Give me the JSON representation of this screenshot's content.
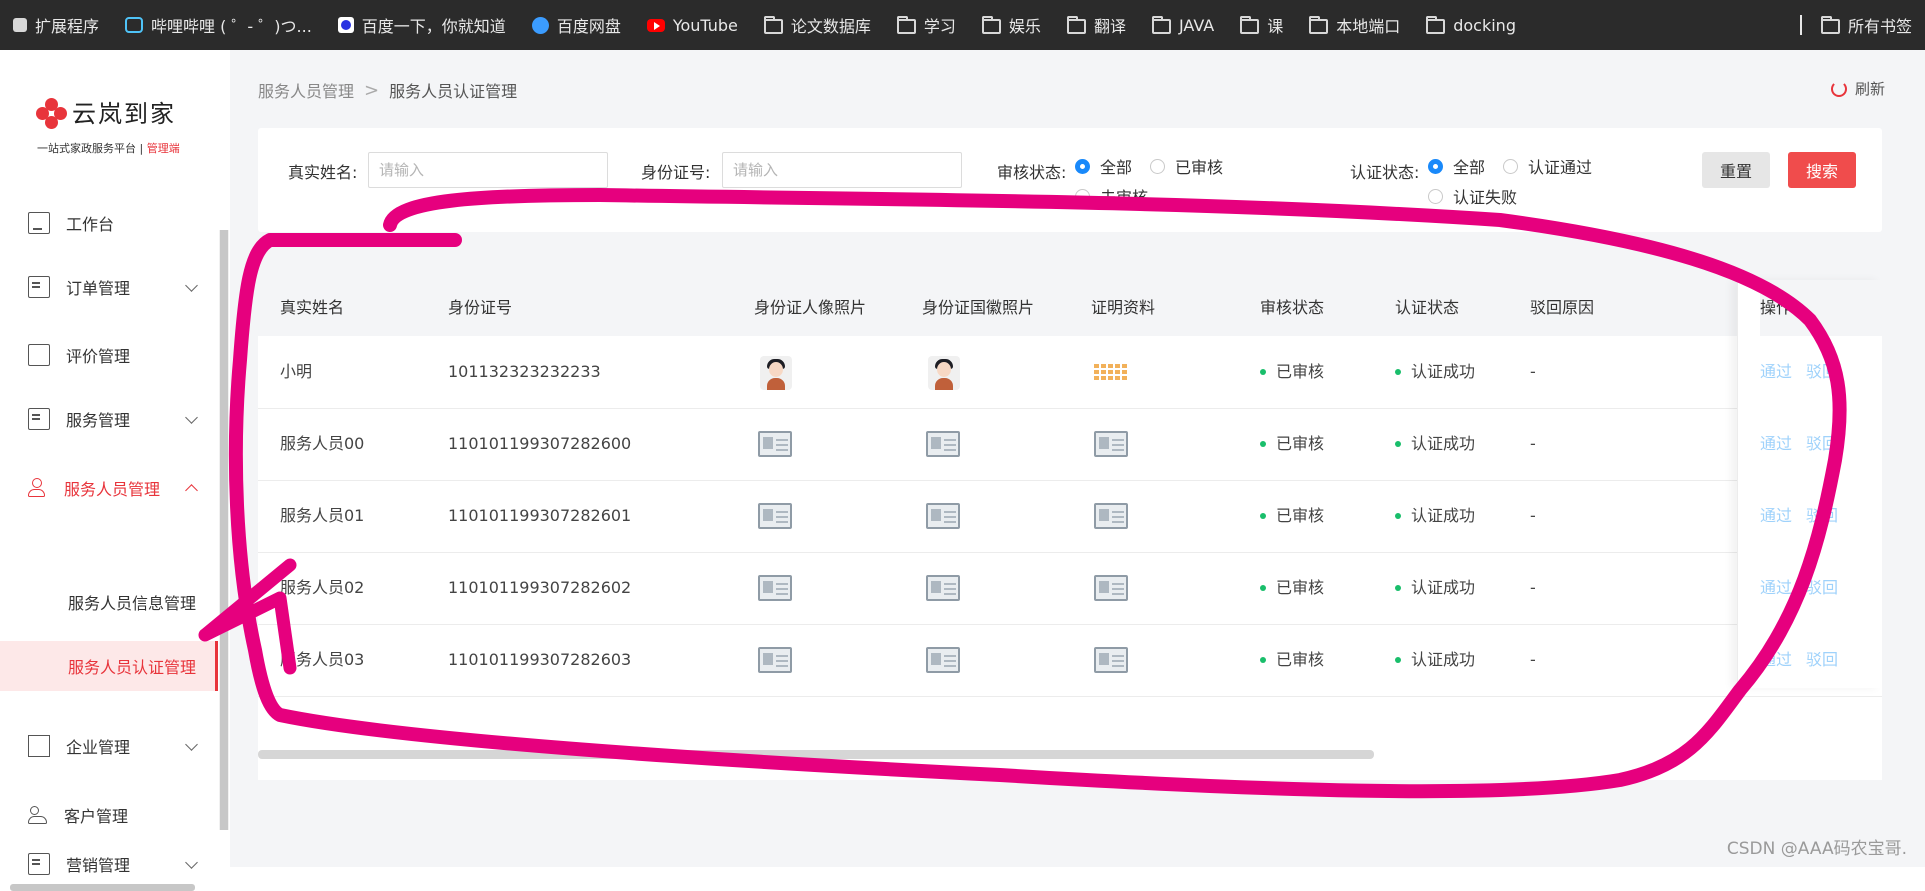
{
  "bookmarks": {
    "items": [
      {
        "label": "扩展程序",
        "icon": "puzzle-icon"
      },
      {
        "label": "哔哩哔哩 ( ゜- ゜)つ...",
        "icon": "bilibili-icon"
      },
      {
        "label": "百度一下，你就知道",
        "icon": "baidu-icon"
      },
      {
        "label": "百度网盘",
        "icon": "baidu-pan-icon"
      },
      {
        "label": "YouTube",
        "icon": "youtube-icon"
      },
      {
        "label": "论文数据库",
        "icon": "folder-icon"
      },
      {
        "label": "学习",
        "icon": "folder-icon"
      },
      {
        "label": "娱乐",
        "icon": "folder-icon"
      },
      {
        "label": "翻译",
        "icon": "folder-icon"
      },
      {
        "label": "JAVA",
        "icon": "folder-icon"
      },
      {
        "label": "课",
        "icon": "folder-icon"
      },
      {
        "label": "本地端口",
        "icon": "folder-icon"
      },
      {
        "label": "docking",
        "icon": "folder-icon"
      }
    ],
    "all_label": "所有书签"
  },
  "brand": {
    "name": "云岚到家",
    "subtitle": "一站式家政服务平台",
    "subtitle_sep": " | ",
    "subtitle_tag": "管理端",
    "accent": "#e8343b"
  },
  "sidebar": {
    "items": [
      {
        "label": "工作台",
        "icon": "monitor-icon"
      },
      {
        "label": "订单管理",
        "icon": "clipboard-icon"
      },
      {
        "label": "评价管理",
        "icon": "edit-icon"
      },
      {
        "label": "服务管理",
        "icon": "service-icon"
      },
      {
        "label": "服务人员管理",
        "icon": "user-icon"
      },
      {
        "label": "企业管理",
        "icon": "building-icon"
      },
      {
        "label": "客户管理",
        "icon": "people-icon"
      },
      {
        "label": "营销管理",
        "icon": "marketing-icon"
      }
    ],
    "sub_items": [
      {
        "label": "服务人员信息管理"
      },
      {
        "label": "服务人员认证管理"
      }
    ]
  },
  "breadcrumb": {
    "parent": "服务人员管理",
    "sep": ">",
    "current": "服务人员认证管理"
  },
  "refresh_label": "刷新",
  "filters": {
    "name_label": "真实姓名:",
    "name_placeholder": "请输入",
    "id_label": "身份证号:",
    "id_placeholder": "请输入",
    "audit_label": "审核状态:",
    "audit_options": [
      "全部",
      "已审核",
      "未审核"
    ],
    "audit_selected": "全部",
    "cert_label": "认证状态:",
    "cert_options": [
      "全部",
      "认证通过",
      "认证失败"
    ],
    "cert_selected": "全部",
    "reset_label": "重置",
    "search_label": "搜索"
  },
  "table": {
    "columns": [
      "真实姓名",
      "身份证号",
      "身份证人像照片",
      "身份证国徽照片",
      "证明资料",
      "审核状态",
      "认证状态",
      "驳回原因",
      "操作"
    ],
    "rows": [
      {
        "name": "小明",
        "id": "101132323232233",
        "audit": "已审核",
        "cert": "认证成功",
        "reason": "-",
        "photo": "avatar",
        "doc": "document"
      },
      {
        "name": "服务人员00",
        "id": "110101199307282600",
        "audit": "已审核",
        "cert": "认证成功",
        "reason": "-",
        "photo": "idcard",
        "doc": "idcard"
      },
      {
        "name": "服务人员01",
        "id": "110101199307282601",
        "audit": "已审核",
        "cert": "认证成功",
        "reason": "-",
        "photo": "idcard",
        "doc": "idcard"
      },
      {
        "name": "服务人员02",
        "id": "110101199307282602",
        "audit": "已审核",
        "cert": "认证成功",
        "reason": "-",
        "photo": "idcard",
        "doc": "idcard"
      },
      {
        "name": "服务人员03",
        "id": "110101199307282603",
        "audit": "已审核",
        "cert": "认证成功",
        "reason": "-",
        "photo": "idcard",
        "doc": "idcard"
      }
    ],
    "actions": [
      "通过",
      "驳回"
    ],
    "status_color": "#19be6b"
  },
  "annotation_color": "#e6007e",
  "watermark": "CSDN @AAA码农宝哥."
}
